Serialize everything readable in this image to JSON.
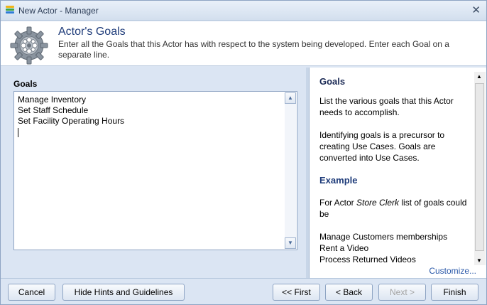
{
  "window": {
    "title": "New Actor - Manager",
    "close_glyph": "✕"
  },
  "header": {
    "title": "Actor's Goals",
    "description": "Enter all the Goals that this Actor has with respect to the system being developed. Enter each Goal on a separate line."
  },
  "goals": {
    "label": "Goals",
    "items": [
      "Manage Inventory",
      "Set Staff Schedule",
      "Set Facility Operating Hours"
    ]
  },
  "hints": {
    "heading": "Goals",
    "paragraphs": [
      "List the various goals that this Actor needs to accomplish.",
      "Identifying goals is a precursor to creating Use Cases. Goals are converted into Use Cases."
    ],
    "example_heading": "Example",
    "example_prefix": "For Actor ",
    "example_actor": "Store Clerk",
    "example_suffix": " list of goals could be",
    "example_items": [
      "Manage Customers memberships",
      "Rent a Video",
      "Process Returned Videos"
    ],
    "customize_link": "Customize..."
  },
  "footer": {
    "cancel": "Cancel",
    "hide_hints": "Hide Hints and Guidelines",
    "first": "<< First",
    "back": "< Back",
    "next": "Next >",
    "finish": "Finish"
  },
  "icons": {
    "app": "colored-bars-icon",
    "header": "gear-icon",
    "scroll_up": "arrow-up-icon",
    "scroll_down": "arrow-down-icon"
  },
  "colors": {
    "title_text": "#1f3c7a",
    "link": "#2857a8",
    "panel_bg": "#dbe5f3"
  }
}
